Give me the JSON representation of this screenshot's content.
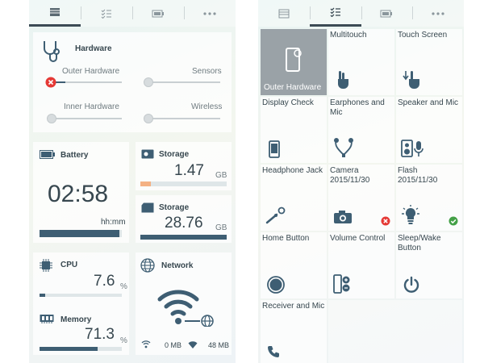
{
  "left_screen": {
    "tabs": [
      {
        "name": "dashboard-tab-icon"
      },
      {
        "name": "checklist-tab-icon"
      },
      {
        "name": "battery-tab-icon"
      },
      {
        "name": "more-tab-icon"
      }
    ],
    "hardware": {
      "title": "Hardware",
      "outer_label": "Outer Hardware",
      "sensors_label": "Sensors",
      "inner_label": "Inner Hardware",
      "wireless_label": "Wireless"
    },
    "battery": {
      "title": "Battery",
      "time": "02:58",
      "unit": "hh:mm",
      "level": 0.97
    },
    "storage1": {
      "title": "Storage",
      "value": "1.47",
      "unit": "GB",
      "level": 0.12
    },
    "storage2": {
      "title": "Storage",
      "value": "28.76",
      "unit": "GB",
      "level": 1.0
    },
    "cpu": {
      "title": "CPU",
      "value": "7.6",
      "unit": "%",
      "level": 0.07
    },
    "memory": {
      "title": "Memory",
      "value": "71.3",
      "unit": "%",
      "level": 0.71
    },
    "network": {
      "title": "Network",
      "mobile": "0 MB",
      "wifi": "48 MB"
    }
  },
  "right_screen": {
    "tiles": [
      {
        "label": "Outer Hardware",
        "selected": true
      },
      {
        "label": "Multitouch"
      },
      {
        "label": "Touch Screen"
      },
      {
        "label": "Display Check"
      },
      {
        "label": "Earphones and Mic"
      },
      {
        "label": "Speaker and Mic"
      },
      {
        "label": "Headphone Jack"
      },
      {
        "label": "Camera",
        "date": "2015/11/30",
        "status": "fail"
      },
      {
        "label": "Flash",
        "date": "2015/11/30",
        "status": "pass"
      },
      {
        "label": "Home Button"
      },
      {
        "label": "Volume Control"
      },
      {
        "label": "Sleep/Wake Button"
      },
      {
        "label": "Receiver and Mic"
      }
    ]
  },
  "colors": {
    "accent": "#3e5e73",
    "fail": "#e53935",
    "pass": "#43a047",
    "storage_low": "#f4b183"
  }
}
